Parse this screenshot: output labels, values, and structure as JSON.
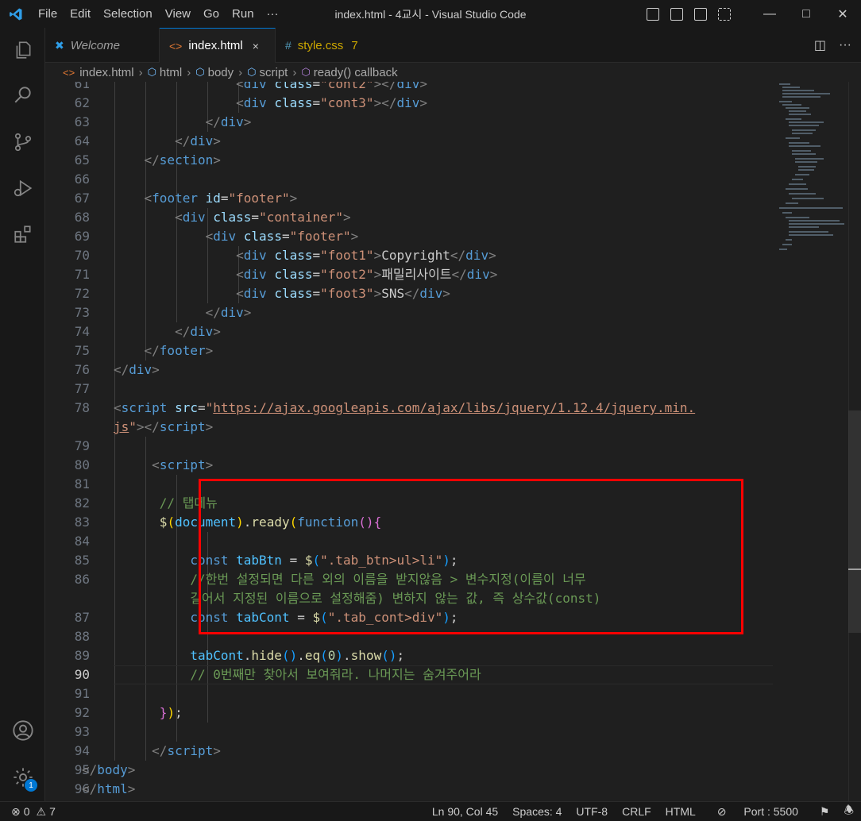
{
  "titlebar": {
    "menu": [
      "File",
      "Edit",
      "Selection",
      "View",
      "Go",
      "Run",
      "···"
    ],
    "title": "index.html - 4교시 - Visual Studio Code"
  },
  "tabs": [
    {
      "label": "Welcome",
      "icon": "vscode-icon",
      "active": false
    },
    {
      "label": "index.html",
      "icon": "html-file-icon",
      "active": true,
      "close": "×"
    },
    {
      "label": "style.css",
      "icon": "css-file-icon",
      "active": false,
      "problems": "7"
    }
  ],
  "breadcrumb": [
    "index.html",
    "html",
    "body",
    "script",
    "ready() callback"
  ],
  "activity_badge": "1",
  "editor": {
    "line_numbers": [
      "61",
      "62",
      "63",
      "64",
      "65",
      "66",
      "67",
      "68",
      "69",
      "70",
      "71",
      "72",
      "73",
      "74",
      "75",
      "76",
      "77",
      "78",
      "",
      "79",
      "80",
      "81",
      "82",
      "83",
      "84",
      "85",
      "86",
      "",
      "87",
      "88",
      "89",
      "90",
      "91",
      "92",
      "93",
      "94",
      "95",
      "96"
    ],
    "current_line": "90",
    "code": {
      "l61_class": "\"cont2\"",
      "l62_class": "\"cont3\"",
      "l67_id": "\"footer\"",
      "l68_class": "\"container\"",
      "l69_class": "\"footer\"",
      "l70_class": "\"foot1\"",
      "l70_text": "Copyright",
      "l71_class": "\"foot2\"",
      "l71_text": "패밀리사이트",
      "l72_class": "\"foot3\"",
      "l72_text": "SNS",
      "l78_src_a": "https://ajax.googleapis.com/ajax/libs/jquery/1.12.4/jquery.min.",
      "l78_src_b": "js",
      "l82_comment": "// 탭메뉴",
      "l85_selector": "\".tab_btn>ul>li\"",
      "l86_comment_a": "//한번 설정되면 다른 외의 이름을 받지않음 > 변수지정(이름이 너무",
      "l86_comment_b": "길어서 지정된 이름으로 설정해줌) 변하지 않는 값, 즉 상수값(const)",
      "l87_selector": "\".tab_cont>div\"",
      "l89_index": "0",
      "l90_comment": "// 0번째만 찾아서 보여줘라. 나머지는 숨겨주어라"
    }
  },
  "statusbar": {
    "errors": "0",
    "warnings": "7",
    "position": "Ln 90, Col 45",
    "spaces": "Spaces: 4",
    "encoding": "UTF-8",
    "eol": "CRLF",
    "language": "HTML",
    "port": "Port : 5500"
  },
  "colors": {
    "highlight_box": "#ff0000",
    "accent": "#0078d4"
  }
}
